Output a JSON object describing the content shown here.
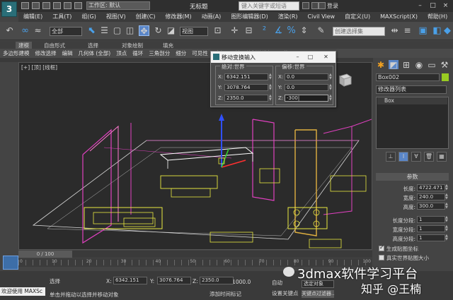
{
  "app": {
    "logo_text": "3",
    "workspace": "工作区: 默认",
    "doc_title": "无标题",
    "search_placeholder": "键入关键字或短语",
    "sign_in": "登录"
  },
  "menu": {
    "items": [
      "编辑(E)",
      "工具(T)",
      "组(G)",
      "视图(V)",
      "创建(C)",
      "修改器(M)",
      "动画(A)",
      "图形编辑器(D)",
      "渲染(R)",
      "Civil View",
      "自定义(U)",
      "MAXScript(X)",
      "帮助(H)"
    ]
  },
  "toolbar": {
    "selection_filter": "全部",
    "reference_coord": "视图",
    "named_selection_placeholder": "创建选择集"
  },
  "ribbon": {
    "tabs": [
      "建模",
      "自由形式",
      "选择",
      "对象绘制",
      "填充"
    ],
    "items": [
      "多边形建模",
      "修改选择",
      "编辑",
      "几何体 (全部)",
      "顶点",
      "循环",
      "三角剖分",
      "细分",
      "可见性",
      "对齐",
      "属性",
      "绘制软选择",
      "置换"
    ]
  },
  "viewport": {
    "label": "[+] [顶] [线框]"
  },
  "dialog": {
    "title": "移动变换输入",
    "absolute": {
      "title": "绝对:世界",
      "x": "6342.151",
      "y": "3078.764",
      "z": "2350.0"
    },
    "offset": {
      "title": "偏移:世界",
      "x": "0.0",
      "y": "0.0",
      "z": "-300|"
    },
    "axis_x": "X:",
    "axis_y": "Y:",
    "axis_z": "Z:"
  },
  "command_panel": {
    "object_name": "Box002",
    "object_color": "#99cc22",
    "modifier_list": "修改器列表",
    "stack_item": "Box",
    "rollout_title": "参数",
    "params": [
      {
        "label": "长度:",
        "value": "4722.471"
      },
      {
        "label": "宽度:",
        "value": "240.0"
      },
      {
        "label": "高度:",
        "value": "300.0"
      },
      {
        "label": "长度分段:",
        "value": "1"
      },
      {
        "label": "宽度分段:",
        "value": "1"
      },
      {
        "label": "高度分段:",
        "value": "1"
      }
    ],
    "checkboxes": [
      {
        "label": "生成贴图坐标",
        "checked": true
      },
      {
        "label": "真实世界贴图大小",
        "checked": false
      }
    ]
  },
  "timeline": {
    "frame": "0 / 100",
    "ticks": [
      "0",
      "10",
      "20",
      "30",
      "40",
      "50",
      "60",
      "70",
      "80",
      "90",
      "100"
    ]
  },
  "status": {
    "maxscript": "欢迎使用 MAXSc",
    "selection": "选择",
    "prompt": "单击并拖动以选择并移动对象",
    "x_label": "X:",
    "x": "6342.151",
    "y_label": "Y:",
    "y": "3076.764",
    "z_label": "Z:",
    "z": "2350.0",
    "grid": "栅格 = 1000.0",
    "add_time_tag": "添加时间标记",
    "auto_key": "自动",
    "set_key": "设置关键点",
    "selected_drop": "选定对象",
    "key_filters": "关键点过滤器..."
  },
  "watermark": {
    "text": "3dmax软件学习平台",
    "zhihu": "知乎 @王楠"
  }
}
